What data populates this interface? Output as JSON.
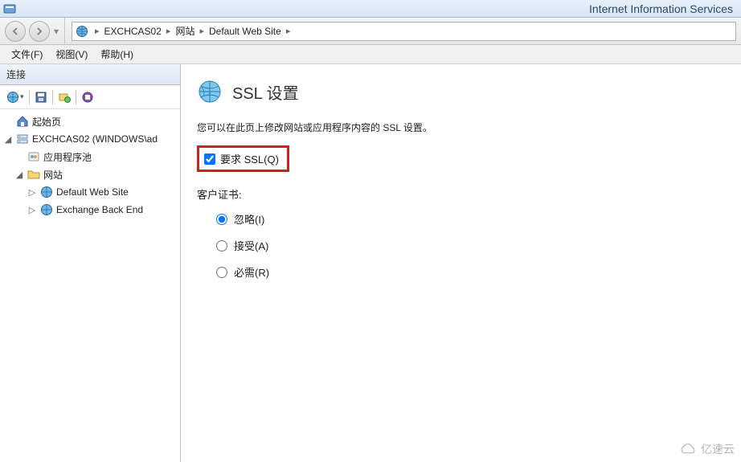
{
  "window": {
    "title": "Internet Information Services"
  },
  "breadcrumb": {
    "items": [
      "EXCHCAS02",
      "网站",
      "Default Web Site"
    ]
  },
  "menu": {
    "file": "文件(F)",
    "view": "视图(V)",
    "help": "帮助(H)"
  },
  "sidebar": {
    "header": "连接",
    "start_page": "起始页",
    "server": "EXCHCAS02 (WINDOWS\\ad",
    "app_pools": "应用程序池",
    "sites": "网站",
    "default_site": "Default Web Site",
    "backend": "Exchange Back End"
  },
  "content": {
    "title": "SSL 设置",
    "description": "您可以在此页上修改网站或应用程序内容的 SSL 设置。",
    "require_ssl": "要求 SSL(Q)",
    "client_cert_label": "客户证书:",
    "radio_ignore": "忽略(I)",
    "radio_accept": "接受(A)",
    "radio_require": "必需(R)"
  },
  "watermark": {
    "text": "亿速云"
  }
}
